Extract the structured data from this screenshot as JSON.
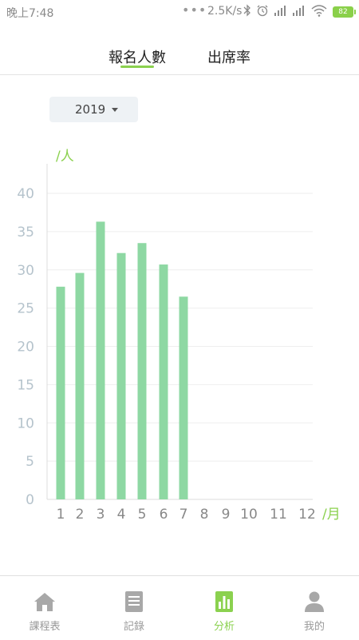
{
  "status_bar": {
    "time": "晚上7:48",
    "dots": "•••",
    "speed": "2.5K/s",
    "battery": "82",
    "battery_color": "#8ad04a"
  },
  "tabs": [
    {
      "label": "報名人數",
      "active": true
    },
    {
      "label": "出席率",
      "active": false
    }
  ],
  "accent_color": "#8bd14f",
  "year_selector": {
    "value": "2019"
  },
  "chart_data": {
    "type": "bar",
    "ylabel": "/人",
    "xlabel": "/月",
    "ylim": [
      0,
      40
    ],
    "yticks": [
      0,
      5,
      10,
      15,
      20,
      25,
      30,
      35,
      40
    ],
    "categories": [
      "1",
      "2",
      "3",
      "4",
      "5",
      "6",
      "7",
      "8",
      "9",
      "10",
      "11",
      "12"
    ],
    "values": [
      27.8,
      29.6,
      36.3,
      32.2,
      33.5,
      30.7,
      26.5,
      null,
      null,
      null,
      null,
      null
    ],
    "bar_color": "#8ed8a3",
    "grid": true
  },
  "bottom_nav": [
    {
      "label": "課程表",
      "icon": "home-icon",
      "active": false
    },
    {
      "label": "記錄",
      "icon": "document-icon",
      "active": false
    },
    {
      "label": "分析",
      "icon": "bar-chart-icon",
      "active": true
    },
    {
      "label": "我的",
      "icon": "person-icon",
      "active": false
    }
  ]
}
